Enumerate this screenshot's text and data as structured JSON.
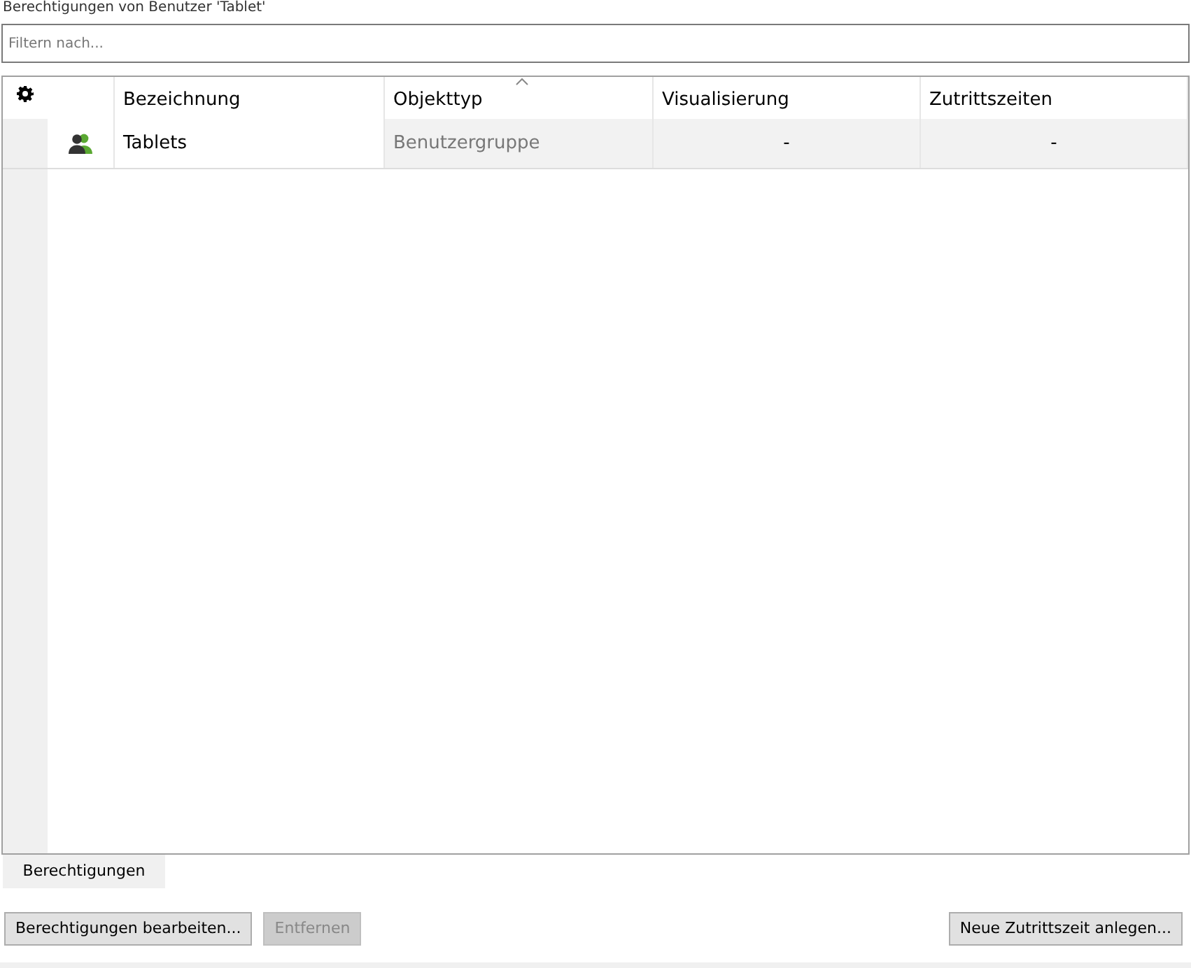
{
  "title": "Berechtigungen von Benutzer 'Tablet'",
  "filter": {
    "placeholder": "Filtern nach..."
  },
  "table": {
    "columns": [
      {
        "label": "Bezeichnung",
        "sorted": false
      },
      {
        "label": "Objekttyp",
        "sorted": true
      },
      {
        "label": "Visualisierung",
        "sorted": false
      },
      {
        "label": "Zutrittszeiten",
        "sorted": false
      }
    ],
    "rows": [
      {
        "kind": "group",
        "cells": [
          "Tablets",
          "Benutzergruppe",
          "-",
          "-"
        ]
      }
    ]
  },
  "tabs": [
    {
      "label": "Berechtigungen",
      "selected": true
    }
  ],
  "buttons": [
    {
      "label": "Berechtigungen bearbeiten...",
      "disabled": false
    },
    {
      "label": "Entfernen",
      "disabled": true
    }
  ],
  "right_buttons": [
    {
      "label": "Neue Zutrittszeit anlegen...",
      "disabled": false
    }
  ]
}
